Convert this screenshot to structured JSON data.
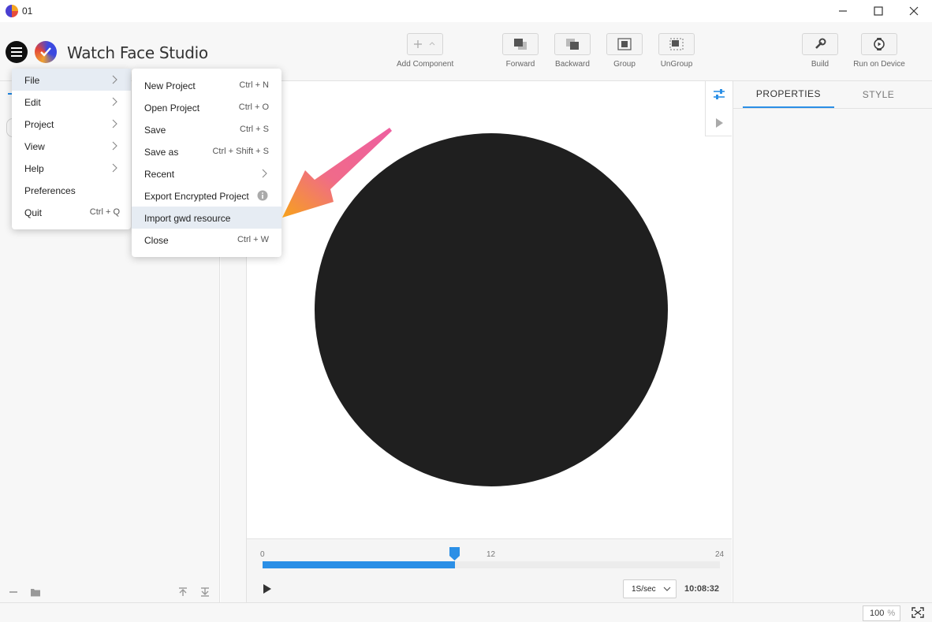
{
  "window": {
    "title": "01"
  },
  "app": {
    "name": "Watch Face Studio"
  },
  "toolbar": {
    "add_component": "Add Component",
    "forward": "Forward",
    "backward": "Backward",
    "group": "Group",
    "ungroup": "UnGroup",
    "build": "Build",
    "run_on_device": "Run on Device"
  },
  "main_menu": {
    "items": [
      {
        "label": "File",
        "has_submenu": true,
        "highlighted": true
      },
      {
        "label": "Edit",
        "has_submenu": true
      },
      {
        "label": "Project",
        "has_submenu": true
      },
      {
        "label": "View",
        "has_submenu": true
      },
      {
        "label": "Help",
        "has_submenu": true
      },
      {
        "label": "Preferences"
      },
      {
        "label": "Quit",
        "shortcut": "Ctrl + Q"
      }
    ]
  },
  "file_menu": {
    "items": [
      {
        "label": "New Project",
        "shortcut": "Ctrl + N"
      },
      {
        "label": "Open Project",
        "shortcut": "Ctrl + O"
      },
      {
        "label": "Save",
        "shortcut": "Ctrl + S"
      },
      {
        "label": "Save as",
        "shortcut": "Ctrl + Shift + S"
      },
      {
        "label": "Recent",
        "has_submenu": true
      },
      {
        "label": "Export Encrypted Project",
        "info_icon": true
      },
      {
        "label": "Import gwd resource",
        "highlighted": true
      },
      {
        "label": "Close",
        "shortcut": "Ctrl + W"
      }
    ]
  },
  "timeline": {
    "tick_start": "0",
    "tick_mid": "12",
    "tick_end": "24",
    "progress": 0.42,
    "speed": "1S/sec",
    "time": "10:08:32"
  },
  "right_panel": {
    "tab_properties": "PROPERTIES",
    "tab_style": "STYLE"
  },
  "status": {
    "zoom_value": "100",
    "zoom_unit": "%"
  },
  "colors": {
    "accent": "#2b8fe6",
    "watch_face": "#1f1f1f",
    "menu_highlight": "#e6ecf3",
    "annotation_arrow": "#f0609a"
  }
}
